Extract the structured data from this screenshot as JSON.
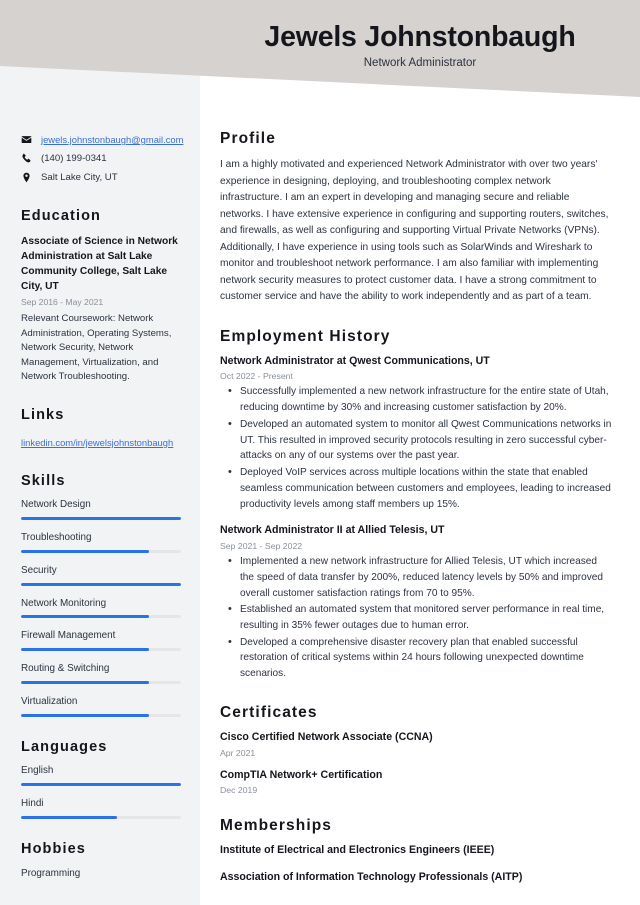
{
  "theme": {
    "header_band": "#d5d2cf",
    "sidebar_bg": "#f1f3f5",
    "accent": "#2a72ea",
    "link": "#3a6fd8",
    "text_dark": "#14161c",
    "text_body": "#2c3340",
    "text_muted": "#8a9099"
  },
  "header": {
    "name": "Jewels Johnstonbaugh",
    "title": "Network Administrator"
  },
  "contact": {
    "email": "jewels.johnstonbaugh@gmail.com",
    "phone": "(140) 199-0341",
    "location": "Salt Lake City, UT"
  },
  "education": {
    "heading": "Education",
    "entries": [
      {
        "degree": "Associate of Science in Network Administration at Salt Lake Community College, Salt Lake City, UT",
        "date": "Sep 2016 - May 2021",
        "description": "Relevant Coursework: Network Administration, Operating Systems, Network Security, Network Management, Virtualization, and Network Troubleshooting."
      }
    ]
  },
  "links": {
    "heading": "Links",
    "items": [
      {
        "label": "linkedin.com/in/jewelsjohnstonbaugh"
      }
    ]
  },
  "skills": {
    "heading": "Skills",
    "items": [
      {
        "label": "Network Design",
        "level": 100
      },
      {
        "label": "Troubleshooting",
        "level": 80
      },
      {
        "label": "Security",
        "level": 100
      },
      {
        "label": "Network Monitoring",
        "level": 80
      },
      {
        "label": "Firewall Management",
        "level": 80
      },
      {
        "label": "Routing & Switching",
        "level": 80
      },
      {
        "label": "Virtualization",
        "level": 80
      }
    ]
  },
  "languages": {
    "heading": "Languages",
    "items": [
      {
        "label": "English",
        "level": 100
      },
      {
        "label": "Hindi",
        "level": 60
      }
    ]
  },
  "hobbies": {
    "heading": "Hobbies",
    "items": [
      {
        "label": "Programming"
      }
    ]
  },
  "profile": {
    "heading": "Profile",
    "text": "I am a highly motivated and experienced Network Administrator with over two years' experience in designing, deploying, and troubleshooting complex network infrastructure. I am an expert in developing and managing secure and reliable networks. I have extensive experience in configuring and supporting routers, switches, and firewalls, as well as configuring and supporting Virtual Private Networks (VPNs). Additionally, I have experience in using tools such as SolarWinds and Wireshark to monitor and troubleshoot network performance. I am also familiar with implementing network security measures to protect customer data. I have a strong commitment to customer service and have the ability to work independently and as part of a team."
  },
  "employment": {
    "heading": "Employment History",
    "jobs": [
      {
        "title": "Network Administrator at Qwest Communications, UT",
        "date": "Oct 2022 - Present",
        "bullets": [
          "Successfully implemented a new network infrastructure for the entire state of Utah, reducing downtime by 30% and increasing customer satisfaction by 20%.",
          "Developed an automated system to monitor all Qwest Communications networks in UT. This resulted in improved security protocols resulting in zero successful cyber-attacks on any of our systems over the past year.",
          "Deployed VoIP services across multiple locations within the state that enabled seamless communication between customers and employees, leading to increased productivity levels among staff members up 15%."
        ]
      },
      {
        "title": "Network Administrator II at Allied Telesis, UT",
        "date": "Sep 2021 - Sep 2022",
        "bullets": [
          "Implemented a new network infrastructure for Allied Telesis, UT which increased the speed of data transfer by 200%, reduced latency levels by 50% and improved overall customer satisfaction ratings from 70 to 95%.",
          "Established an automated system that monitored server performance in real time, resulting in 35% fewer outages due to human error.",
          "Developed a comprehensive disaster recovery plan that enabled successful restoration of critical systems within 24 hours following unexpected downtime scenarios."
        ]
      }
    ]
  },
  "certificates": {
    "heading": "Certificates",
    "items": [
      {
        "name": "Cisco Certified Network Associate (CCNA)",
        "date": "Apr 2021"
      },
      {
        "name": "CompTIA Network+ Certification",
        "date": "Dec 2019"
      }
    ]
  },
  "memberships": {
    "heading": "Memberships",
    "items": [
      {
        "name": "Institute of Electrical and Electronics Engineers (IEEE)"
      },
      {
        "name": "Association of Information Technology Professionals (AITP)"
      }
    ]
  }
}
